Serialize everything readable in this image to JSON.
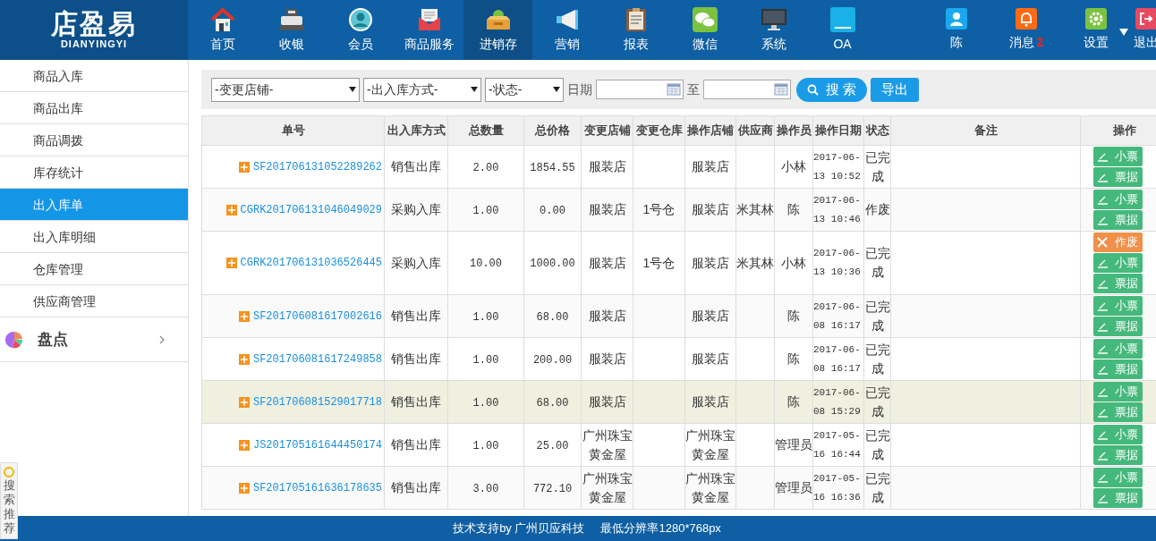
{
  "logo": {
    "title": "店盈易",
    "subtitle": "DIANYINGYI"
  },
  "nav": [
    {
      "label": "首页",
      "selected": false
    },
    {
      "label": "收银",
      "selected": false
    },
    {
      "label": "会员",
      "selected": false
    },
    {
      "label": "商品服务",
      "selected": false
    },
    {
      "label": "进销存",
      "selected": true
    },
    {
      "label": "营销",
      "selected": false
    },
    {
      "label": "报表",
      "selected": false
    },
    {
      "label": "微信",
      "selected": false
    },
    {
      "label": "系统",
      "selected": false
    },
    {
      "label": "OA",
      "selected": false
    }
  ],
  "user_menu": [
    {
      "label": "陈"
    },
    {
      "label": "消息",
      "badge": "2"
    },
    {
      "label": "设置",
      "dropdown": true
    },
    {
      "label": "退出"
    }
  ],
  "sidebar": {
    "items": [
      {
        "label": "商品入库",
        "selected": false
      },
      {
        "label": "商品出库",
        "selected": false
      },
      {
        "label": "商品调拨",
        "selected": false
      },
      {
        "label": "库存统计",
        "selected": false
      },
      {
        "label": "出入库单",
        "selected": true
      },
      {
        "label": "出入库明细",
        "selected": false
      },
      {
        "label": "仓库管理",
        "selected": false
      },
      {
        "label": "供应商管理",
        "selected": false
      }
    ],
    "group": {
      "label": "盘点",
      "expanded": false
    }
  },
  "search_widget": {
    "label": "搜索推荐"
  },
  "filters": {
    "selects": [
      "-变更店铺-",
      "-出入库方式-",
      "-状态-"
    ],
    "date_label": "日期",
    "date_separator": "至",
    "search_button": "搜 索",
    "export_button": "导出"
  },
  "table": {
    "columns": [
      "单号",
      "出入库方式",
      "总数量",
      "总价格",
      "变更店铺",
      "变更仓库",
      "操作店铺",
      "供应商",
      "操作员",
      "操作日期",
      "状态",
      "备注",
      "操作"
    ],
    "rows": [
      {
        "selected": false,
        "order_no": "SF201706131052289262",
        "method": "销售出库",
        "quantity": "2.00",
        "total_price": "1854.55",
        "change_store": "服装店",
        "operating_store": "服装店",
        "operator": "小林",
        "date": "2017-06-13 10:52",
        "status": "已完成",
        "actions": [
          {
            "kind": "edit",
            "label": "小票"
          },
          {
            "kind": "edit",
            "label": "票据"
          }
        ]
      },
      {
        "selected": false,
        "order_no": "CGRK201706131046049029",
        "method": "采购入库",
        "quantity": "1.00",
        "total_price": "0.00",
        "change_store": "服装店",
        "change_warehouse": "1号仓",
        "operating_store": "服装店",
        "supplier": "米其林",
        "operator": "陈",
        "date": "2017-06-13 10:46",
        "status": "作废",
        "actions": [
          {
            "kind": "edit",
            "label": "小票"
          },
          {
            "kind": "edit",
            "label": "票据"
          }
        ]
      },
      {
        "selected": false,
        "order_no": "CGRK201706131036526445",
        "method": "采购入库",
        "quantity": "10.00",
        "total_price": "1000.00",
        "change_store": "服装店",
        "change_warehouse": "1号仓",
        "operating_store": "服装店",
        "supplier": "米其林",
        "operator": "小林",
        "date": "2017-06-13 10:36",
        "status": "已完成",
        "actions": [
          {
            "kind": "void",
            "label": "作废"
          },
          {
            "kind": "edit",
            "label": "小票"
          },
          {
            "kind": "edit",
            "label": "票据"
          }
        ]
      },
      {
        "selected": false,
        "order_no": "SF201706081617002616",
        "method": "销售出库",
        "quantity": "1.00",
        "total_price": "68.00",
        "change_store": "服装店",
        "operating_store": "服装店",
        "operator": "陈",
        "date": "2017-06-08 16:17",
        "status": "已完成",
        "actions": [
          {
            "kind": "edit",
            "label": "小票"
          },
          {
            "kind": "edit",
            "label": "票据"
          }
        ]
      },
      {
        "selected": false,
        "order_no": "SF201706081617249858",
        "method": "销售出库",
        "quantity": "1.00",
        "total_price": "200.00",
        "change_store": "服装店",
        "operating_store": "服装店",
        "operator": "陈",
        "date": "2017-06-08 16:17",
        "status": "已完成",
        "actions": [
          {
            "kind": "edit",
            "label": "小票"
          },
          {
            "kind": "edit",
            "label": "票据"
          }
        ]
      },
      {
        "selected": true,
        "order_no": "SF201706081529017718",
        "method": "销售出库",
        "quantity": "1.00",
        "total_price": "68.00",
        "change_store": "服装店",
        "operating_store": "服装店",
        "operator": "陈",
        "date": "2017-06-08 15:29",
        "status": "已完成",
        "actions": [
          {
            "kind": "edit",
            "label": "小票"
          },
          {
            "kind": "edit",
            "label": "票据"
          }
        ]
      },
      {
        "selected": false,
        "order_no": "JS201705161644450174",
        "method": "销售出库",
        "quantity": "1.00",
        "total_price": "25.00",
        "change_store": "广州珠宝黄金屋",
        "operating_store": "广州珠宝黄金屋",
        "operator": "管理员",
        "date": "2017-05-16 16:44",
        "status": "已完成",
        "actions": [
          {
            "kind": "edit",
            "label": "小票"
          },
          {
            "kind": "edit",
            "label": "票据"
          }
        ]
      },
      {
        "selected": false,
        "order_no": "SF201705161636178635",
        "method": "销售出库",
        "quantity": "3.00",
        "total_price": "772.10",
        "change_store": "广州珠宝黄金屋",
        "operating_store": "广州珠宝黄金屋",
        "operator": "管理员",
        "date": "2017-05-16 16:36",
        "status": "已完成",
        "actions": [
          {
            "kind": "edit",
            "label": "小票"
          },
          {
            "kind": "edit",
            "label": "票据"
          }
        ]
      }
    ]
  },
  "footer": {
    "support": "技术支持by 广州贝应科技",
    "resolution": "最低分辨率1280*768px"
  }
}
